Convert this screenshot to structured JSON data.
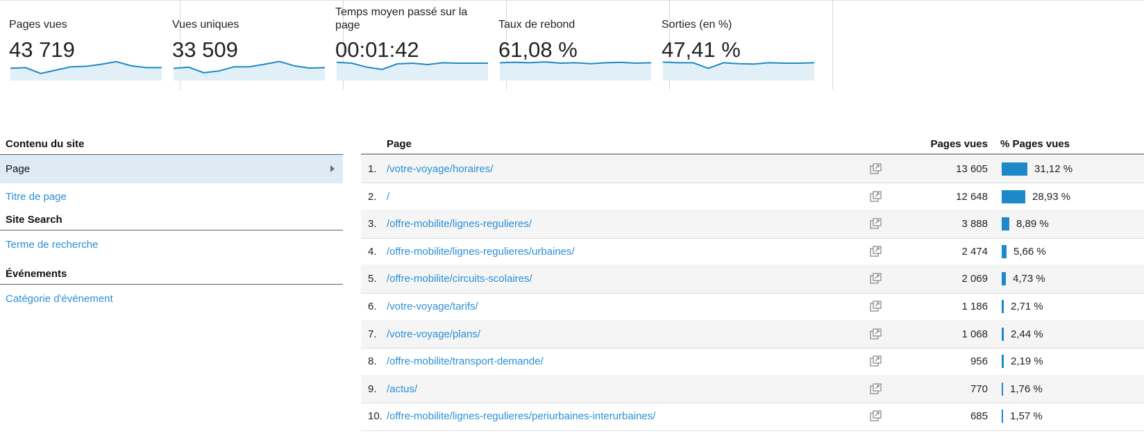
{
  "metrics": [
    {
      "label": "Pages vues",
      "value": "43 719",
      "spark": [
        0.55,
        0.58,
        0.32,
        0.47,
        0.62,
        0.64,
        0.73,
        0.85,
        0.66,
        0.58,
        0.58
      ]
    },
    {
      "label": "Vues uniques",
      "value": "33 509",
      "spark": [
        0.55,
        0.6,
        0.35,
        0.43,
        0.62,
        0.62,
        0.73,
        0.86,
        0.66,
        0.56,
        0.58
      ]
    },
    {
      "label": "Temps moyen passé sur la page",
      "value": "00:01:42",
      "spark": [
        0.82,
        0.78,
        0.6,
        0.5,
        0.75,
        0.78,
        0.72,
        0.8,
        0.78,
        0.78,
        0.78
      ]
    },
    {
      "label": "Taux de rebond",
      "value": "61,08 %",
      "spark": [
        0.8,
        0.82,
        0.8,
        0.84,
        0.78,
        0.8,
        0.76,
        0.8,
        0.82,
        0.78,
        0.8
      ]
    },
    {
      "label": "Sorties (en %)",
      "value": "47,41 %",
      "spark": [
        0.83,
        0.8,
        0.8,
        0.55,
        0.8,
        0.76,
        0.74,
        0.8,
        0.78,
        0.78,
        0.8
      ]
    }
  ],
  "colors": {
    "accent": "#1d89c9",
    "link": "#2b8fd6",
    "selected_bg": "#deebf5",
    "spark_fill": "#e1eff7"
  },
  "nav": {
    "section1": "Contenu du site",
    "page": "Page",
    "titre": "Titre de page",
    "section2": "Site Search",
    "terme": "Terme de recherche",
    "section3": "Événements",
    "categorie": "Catégorie d'événement"
  },
  "table": {
    "col_page": "Page",
    "col_pageviews": "Pages vues",
    "col_pct": "% Pages vues",
    "rows": [
      {
        "idx": "1.",
        "url": "/votre-voyage/horaires/",
        "views": "13 605",
        "pct": "31,12 %",
        "share": 0.3112
      },
      {
        "idx": "2.",
        "url": "/",
        "views": "12 648",
        "pct": "28,93 %",
        "share": 0.2893
      },
      {
        "idx": "3.",
        "url": "/offre-mobilite/lignes-regulieres/",
        "views": "3 888",
        "pct": "8,89 %",
        "share": 0.0889
      },
      {
        "idx": "4.",
        "url": "/offre-mobilite/lignes-regulieres/urbaines/",
        "views": "2 474",
        "pct": "5,66 %",
        "share": 0.0566
      },
      {
        "idx": "5.",
        "url": "/offre-mobilite/circuits-scolaires/",
        "views": "2 069",
        "pct": "4,73 %",
        "share": 0.0473
      },
      {
        "idx": "6.",
        "url": "/votre-voyage/tarifs/",
        "views": "1 186",
        "pct": "2,71 %",
        "share": 0.0271
      },
      {
        "idx": "7.",
        "url": "/votre-voyage/plans/",
        "views": "1 068",
        "pct": "2,44 %",
        "share": 0.0244
      },
      {
        "idx": "8.",
        "url": "/offre-mobilite/transport-demande/",
        "views": "956",
        "pct": "2,19 %",
        "share": 0.0219
      },
      {
        "idx": "9.",
        "url": "/actus/",
        "views": "770",
        "pct": "1,76 %",
        "share": 0.0176
      },
      {
        "idx": "10.",
        "url": "/offre-mobilite/lignes-regulieres/periurbaines-interurbaines/",
        "views": "685",
        "pct": "1,57 %",
        "share": 0.0157
      }
    ]
  }
}
